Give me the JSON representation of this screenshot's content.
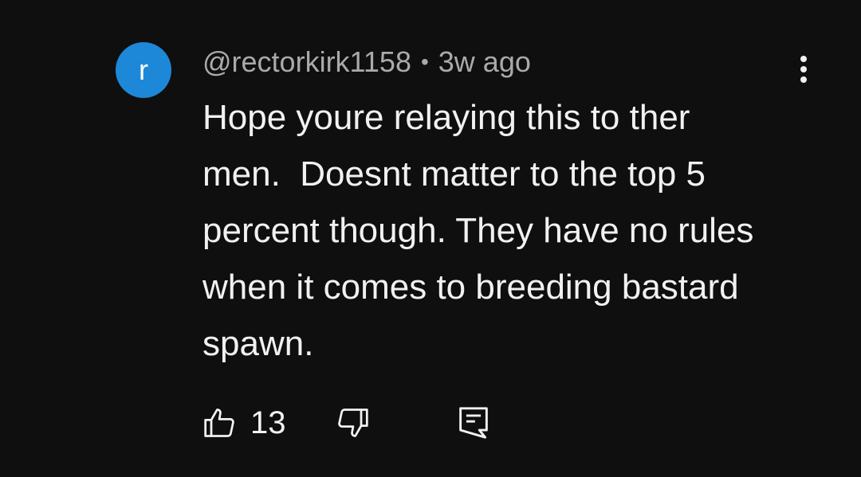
{
  "comment": {
    "avatar_letter": "r",
    "author": "@rectorkirk1158",
    "separator": "•",
    "age": "3w ago",
    "text": "Hope youre relaying this to ther\nmen.  Doesnt matter to the top 5\npercent though. They have no rules\nwhen it comes to breeding bastard\nspawn.",
    "like_count": "13"
  },
  "colors": {
    "background": "#0f0f0f",
    "avatar": "#1e88d8",
    "primary_text": "#f1f1f1",
    "secondary_text": "#aaaaaa"
  },
  "icons": {
    "like": "thumb-up-icon",
    "dislike": "thumb-down-icon",
    "reply": "comment-icon",
    "menu": "more-vert-icon"
  }
}
